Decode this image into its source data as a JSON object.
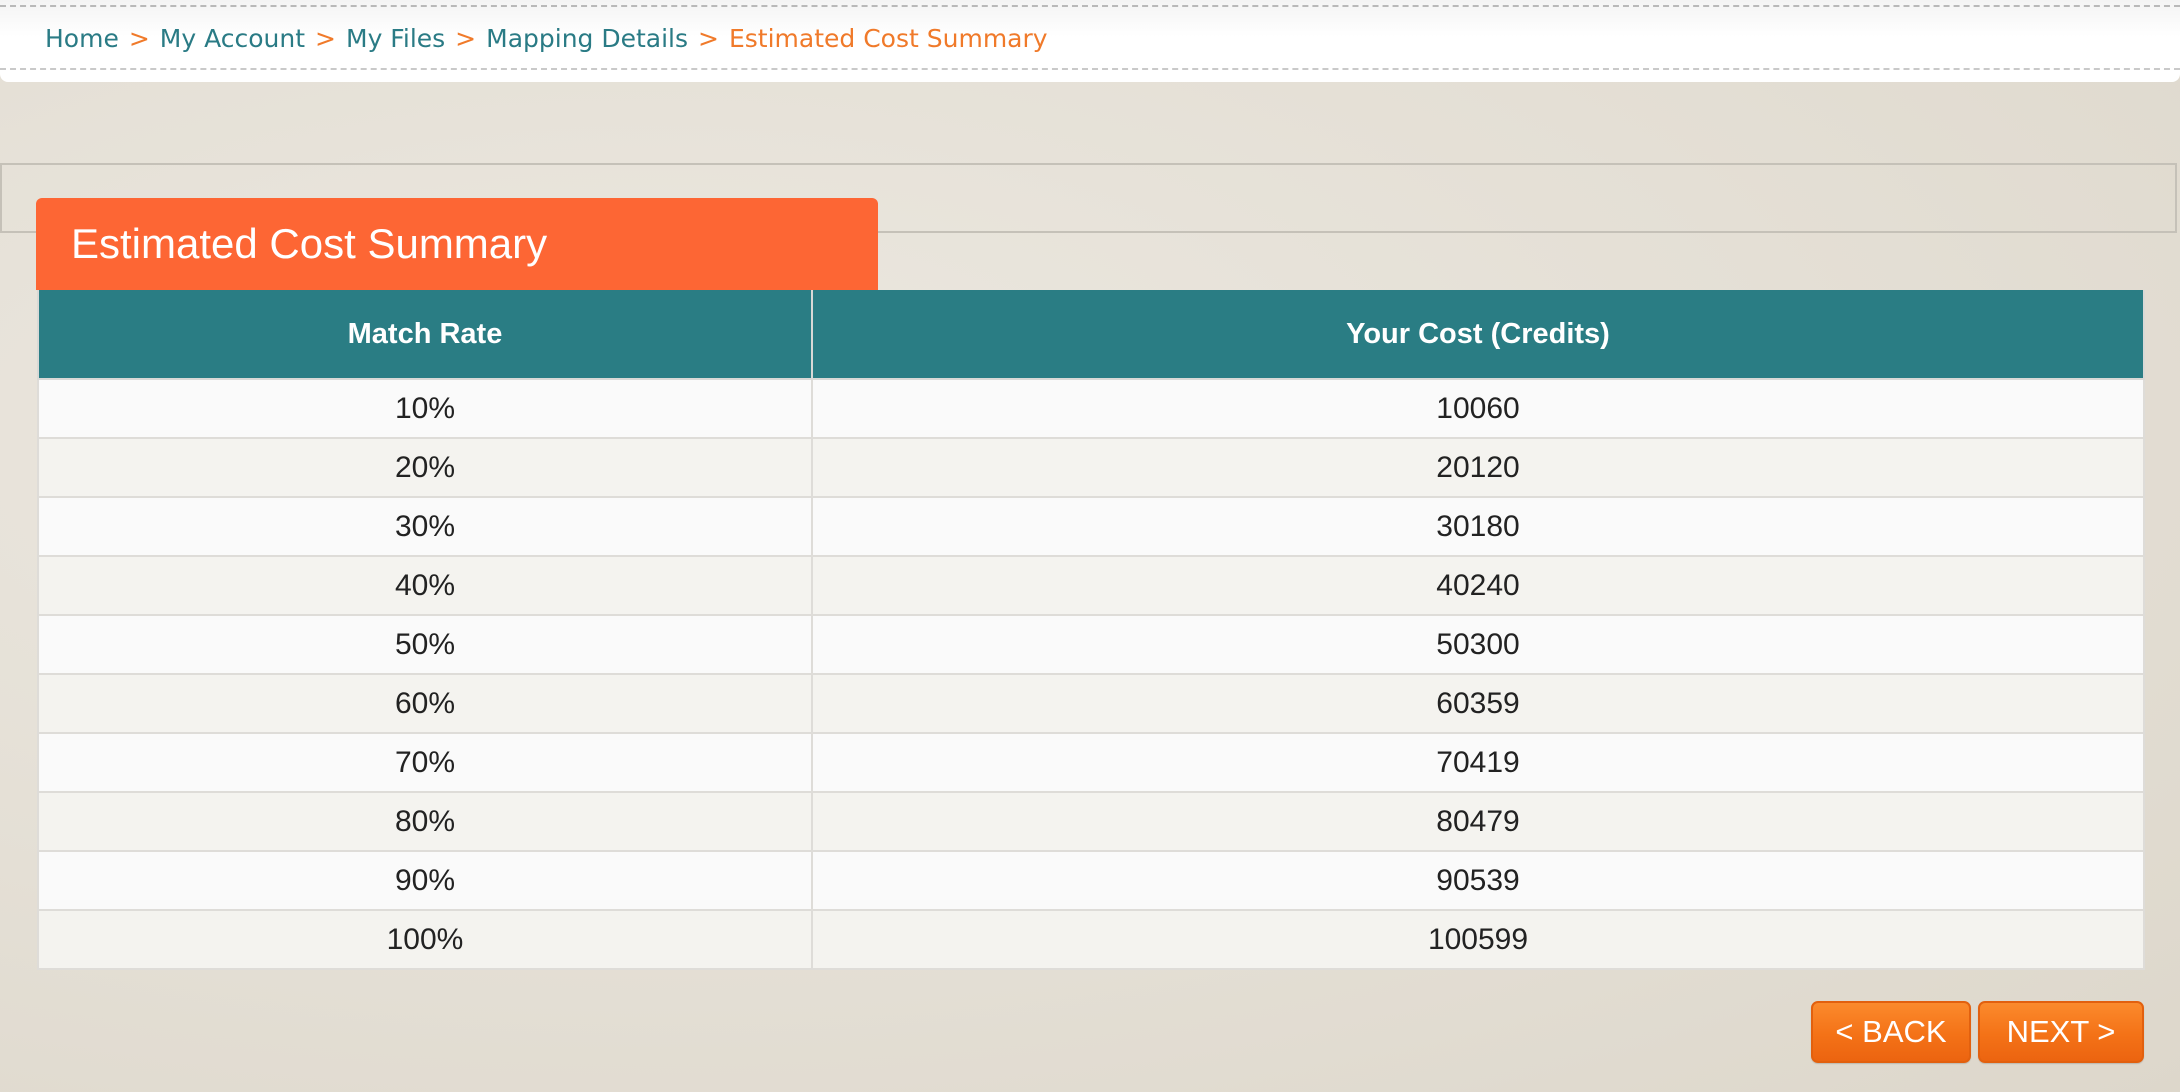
{
  "breadcrumb": {
    "items": [
      "Home",
      "My Account",
      "My Files",
      "Mapping Details"
    ],
    "current": "Estimated Cost Summary",
    "separator": ">"
  },
  "panel": {
    "title": "Estimated Cost Summary"
  },
  "table": {
    "headers": [
      "Match Rate",
      "Your Cost (Credits)"
    ],
    "rows": [
      [
        "10%",
        "10060"
      ],
      [
        "20%",
        "20120"
      ],
      [
        "30%",
        "30180"
      ],
      [
        "40%",
        "40240"
      ],
      [
        "50%",
        "50300"
      ],
      [
        "60%",
        "60359"
      ],
      [
        "70%",
        "70419"
      ],
      [
        "80%",
        "80479"
      ],
      [
        "90%",
        "90539"
      ],
      [
        "100%",
        "100599"
      ]
    ]
  },
  "actions": {
    "back_label": "< BACK",
    "next_label": "NEXT >"
  },
  "colors": {
    "accent_orange": "#fd6634",
    "teal": "#2a7d84",
    "button_orange": "#f47217"
  }
}
